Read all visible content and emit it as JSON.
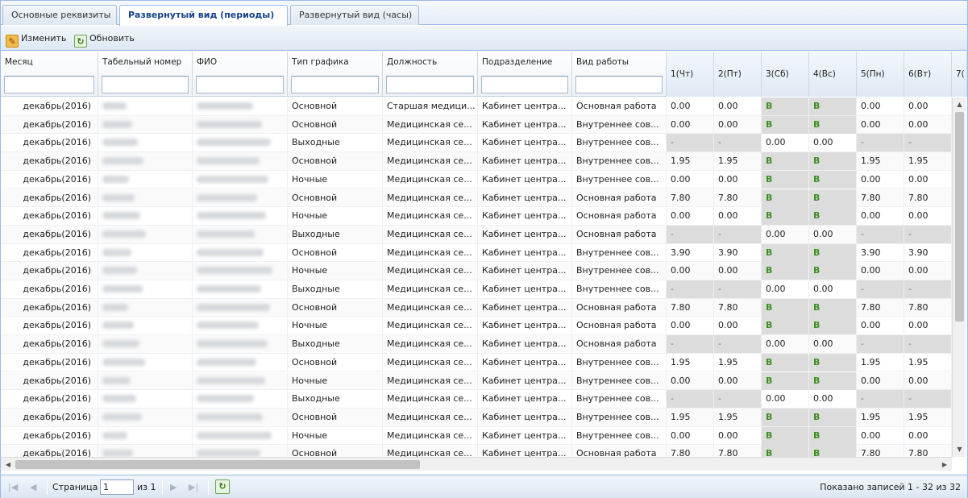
{
  "tabs": [
    {
      "label": "Основные реквизиты",
      "active": false
    },
    {
      "label": "Развернутый вид (периоды)",
      "active": true
    },
    {
      "label": "Развернутый вид (часы)",
      "active": false
    }
  ],
  "toolbar": {
    "edit_label": "Изменить",
    "edit_icon": "edit-icon",
    "refresh_label": "Обновить",
    "refresh_icon": "refresh-icon"
  },
  "columns": [
    "Месяц",
    "Табельный номер",
    "ФИО",
    "Тип графика",
    "Должность",
    "Подразделение",
    "Вид работы",
    "1(Чт)",
    "2(Пт)",
    "3(Сб)",
    "4(Вс)",
    "5(Пн)",
    "6(Вт)",
    "7("
  ],
  "rows": [
    [
      "декабрь(2016)",
      "Основной",
      "Старшая медици...",
      "Кабинет центра...",
      "Основная работа",
      "0.00",
      "0.00",
      "В",
      "В",
      "0.00",
      "0.00"
    ],
    [
      "декабрь(2016)",
      "Основной",
      "Медицинская се...",
      "Кабинет центра...",
      "Внутреннее сов...",
      "0.00",
      "0.00",
      "В",
      "В",
      "0.00",
      "0.00"
    ],
    [
      "декабрь(2016)",
      "Выходные",
      "Медицинская се...",
      "Кабинет центра...",
      "Внутреннее сов...",
      "-",
      "-",
      "0.00",
      "0.00",
      "-",
      "-"
    ],
    [
      "декабрь(2016)",
      "Основной",
      "Медицинская се...",
      "Кабинет центра...",
      "Внутреннее сов...",
      "1.95",
      "1.95",
      "В",
      "В",
      "1.95",
      "1.95"
    ],
    [
      "декабрь(2016)",
      "Ночные",
      "Медицинская се...",
      "Кабинет центра...",
      "Внутреннее сов...",
      "0.00",
      "0.00",
      "В",
      "В",
      "0.00",
      "0.00"
    ],
    [
      "декабрь(2016)",
      "Основной",
      "Медицинская се...",
      "Кабинет центра...",
      "Основная работа",
      "7.80",
      "7.80",
      "В",
      "В",
      "7.80",
      "7.80"
    ],
    [
      "декабрь(2016)",
      "Ночные",
      "Медицинская се...",
      "Кабинет центра...",
      "Основная работа",
      "0.00",
      "0.00",
      "В",
      "В",
      "0.00",
      "0.00"
    ],
    [
      "декабрь(2016)",
      "Выходные",
      "Медицинская се...",
      "Кабинет центра...",
      "Основная работа",
      "-",
      "-",
      "0.00",
      "0.00",
      "-",
      "-"
    ],
    [
      "декабрь(2016)",
      "Основной",
      "Медицинская се...",
      "Кабинет центра...",
      "Внутреннее сов...",
      "3.90",
      "3.90",
      "В",
      "В",
      "3.90",
      "3.90"
    ],
    [
      "декабрь(2016)",
      "Ночные",
      "Медицинская се...",
      "Кабинет центра...",
      "Внутреннее сов...",
      "0.00",
      "0.00",
      "В",
      "В",
      "0.00",
      "0.00"
    ],
    [
      "декабрь(2016)",
      "Выходные",
      "Медицинская се...",
      "Кабинет центра...",
      "Внутреннее сов...",
      "-",
      "-",
      "0.00",
      "0.00",
      "-",
      "-"
    ],
    [
      "декабрь(2016)",
      "Основной",
      "Медицинская се...",
      "Кабинет центра...",
      "Основная работа",
      "7.80",
      "7.80",
      "В",
      "В",
      "7.80",
      "7.80"
    ],
    [
      "декабрь(2016)",
      "Ночные",
      "Медицинская се...",
      "Кабинет центра...",
      "Основная работа",
      "0.00",
      "0.00",
      "В",
      "В",
      "0.00",
      "0.00"
    ],
    [
      "декабрь(2016)",
      "Выходные",
      "Медицинская се...",
      "Кабинет центра...",
      "Основная работа",
      "-",
      "-",
      "0.00",
      "0.00",
      "-",
      "-"
    ],
    [
      "декабрь(2016)",
      "Основной",
      "Медицинская се...",
      "Кабинет центра...",
      "Внутреннее сов...",
      "1.95",
      "1.95",
      "В",
      "В",
      "1.95",
      "1.95"
    ],
    [
      "декабрь(2016)",
      "Ночные",
      "Медицинская се...",
      "Кабинет центра...",
      "Внутреннее сов...",
      "0.00",
      "0.00",
      "В",
      "В",
      "0.00",
      "0.00"
    ],
    [
      "декабрь(2016)",
      "Выходные",
      "Медицинская се...",
      "Кабинет центра...",
      "Внутреннее сов...",
      "-",
      "-",
      "0.00",
      "0.00",
      "-",
      "-"
    ],
    [
      "декабрь(2016)",
      "Основной",
      "Медицинская се...",
      "Кабинет центра...",
      "Внутреннее сов...",
      "1.95",
      "1.95",
      "В",
      "В",
      "1.95",
      "1.95"
    ],
    [
      "декабрь(2016)",
      "Ночные",
      "Медицинская се...",
      "Кабинет центра...",
      "Внутреннее сов...",
      "0.00",
      "0.00",
      "В",
      "В",
      "0.00",
      "0.00"
    ],
    [
      "декабрь(2016)",
      "Основной",
      "Медицинская се...",
      "Кабинет центра...",
      "Основная работа",
      "7.80",
      "7.80",
      "В",
      "В",
      "7.80",
      "7.80"
    ]
  ],
  "pager": {
    "page_label": "Страница",
    "page_value": "1",
    "of_label": "из 1",
    "summary": "Показано записей 1 - 32 из 32"
  },
  "colors": {
    "header_border": "#99bbe8",
    "weekend_bg": "#dcdcdc",
    "weekend_text": "#3f8f22",
    "tab_active_text": "#15428b"
  }
}
